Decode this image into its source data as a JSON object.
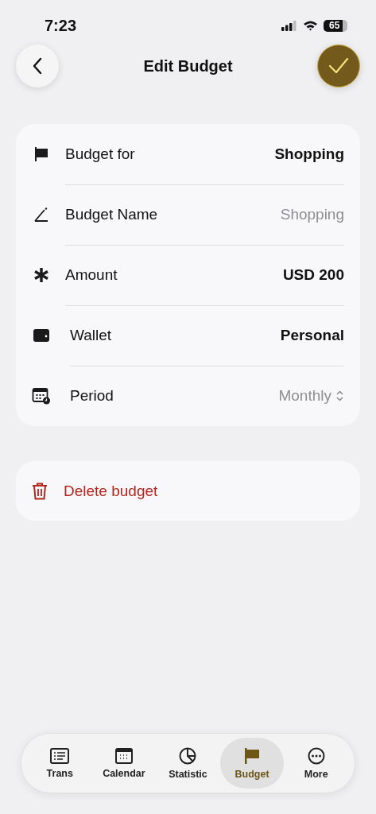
{
  "status_bar": {
    "time": "7:23",
    "battery": "65"
  },
  "header": {
    "title": "Edit Budget"
  },
  "rows": [
    {
      "kind": "value",
      "label": "Budget for",
      "value": "Shopping"
    },
    {
      "kind": "field",
      "label": "Budget Name",
      "placeholder": "Shopping"
    },
    {
      "kind": "value",
      "label": "Amount",
      "value": "USD 200"
    },
    {
      "kind": "value",
      "label": "Wallet",
      "value": "Personal"
    },
    {
      "kind": "picker",
      "label": "Period",
      "value": "Monthly"
    }
  ],
  "delete": {
    "label": "Delete budget"
  },
  "tabs": [
    {
      "label": "Trans",
      "selected": false
    },
    {
      "label": "Calendar",
      "selected": false
    },
    {
      "label": "Statistic",
      "selected": false
    },
    {
      "label": "Budget",
      "selected": true
    },
    {
      "label": "More",
      "selected": false
    }
  ]
}
